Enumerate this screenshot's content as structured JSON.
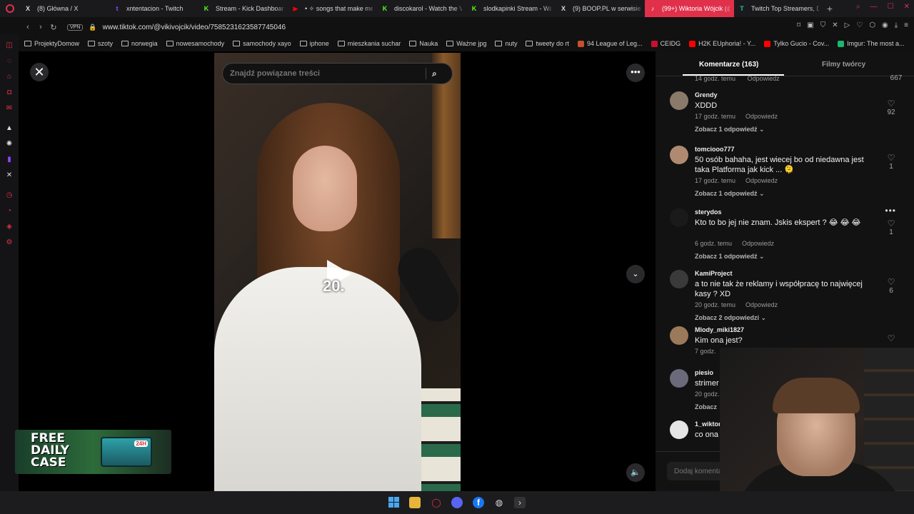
{
  "tabs": [
    {
      "label": "(8) Główna / X",
      "icon": "X",
      "color": "#dddddd",
      "active": false
    },
    {
      "label": "xntentacion - Twitch",
      "icon": "t",
      "color": "#9146ff",
      "active": false
    },
    {
      "label": "Stream - Kick Dashboard",
      "icon": "K",
      "color": "#53fc18",
      "active": false
    },
    {
      "label": "• ✧ songs that make me",
      "icon": "▶",
      "color": "#ff0000",
      "active": false
    },
    {
      "label": "discokarol - Watch the V",
      "icon": "K",
      "color": "#53fc18",
      "active": false
    },
    {
      "label": "slodkapinki Stream - Wat",
      "icon": "K",
      "color": "#53fc18",
      "active": false
    },
    {
      "label": "(9) BOOP.PL w serwisie",
      "icon": "X",
      "color": "#dddddd",
      "active": false
    },
    {
      "label": "(99+) Wiktoria Wójcik (@",
      "icon": "♪",
      "color": "#ffffff",
      "active": true
    },
    {
      "label": "Twitch Top Streamers, D",
      "icon": "T",
      "color": "#22c3a0",
      "active": false
    }
  ],
  "address": {
    "vpn": "VPN",
    "url": "www.tiktok.com/@vikivojcik/video/7585231623587745046"
  },
  "bookmarks": [
    {
      "label": "ProjektyDomow",
      "type": "folder"
    },
    {
      "label": "szoty",
      "type": "folder"
    },
    {
      "label": "norwegia",
      "type": "folder"
    },
    {
      "label": "nowesamochody",
      "type": "folder"
    },
    {
      "label": "samochody xayo",
      "type": "folder"
    },
    {
      "label": "iphone",
      "type": "folder"
    },
    {
      "label": "mieszkania suchar",
      "type": "folder"
    },
    {
      "label": "Nauka",
      "type": "folder"
    },
    {
      "label": "Ważne jpg",
      "type": "folder"
    },
    {
      "label": "nuty",
      "type": "folder"
    },
    {
      "label": "tweety do rt",
      "type": "folder"
    },
    {
      "label": "94 League of Leg...",
      "type": "site",
      "color": "#c8502a"
    },
    {
      "label": "CEIDG",
      "type": "site",
      "color": "#c8102e"
    },
    {
      "label": "H2K EUphoria! - Y...",
      "type": "site",
      "color": "#ff0000"
    },
    {
      "label": "Tylko Gucio - Cov...",
      "type": "site",
      "color": "#ff0000"
    },
    {
      "label": "Imgur: The most a...",
      "type": "site",
      "color": "#1bb76e"
    }
  ],
  "search": {
    "placeholder": "Znajdź powiązane treści"
  },
  "video": {
    "overlay_number": "20."
  },
  "ad": {
    "line1": "FREE",
    "line2": "DAILY",
    "line3": "CASE",
    "badge": "24H"
  },
  "panel": {
    "tab_comments": "Komentarze (163)",
    "tab_creator": "Filmy twórcy",
    "top_meta_time": "14 godz. temu",
    "top_meta_reply": "Odpowiedz",
    "top_likes": "667",
    "add_comment_placeholder": "Dodaj komentarz...",
    "comments": [
      {
        "user": "Grendy",
        "text": "XDDD",
        "time": "17 godz. temu",
        "reply": "Odpowiedz",
        "view": "Zobacz 1 odpowiedź ⌄",
        "likes": "92"
      },
      {
        "user": "tomciooo777",
        "text": "50 osób bahaha, jest wiecej bo od niedawna jest taka Platforma jak kick ... 🫠",
        "time": "17 godz. temu",
        "reply": "Odpowiedz",
        "view": "Zobacz 1 odpowiedź ⌄",
        "likes": "1"
      },
      {
        "user": "sterydos",
        "text": "Kto to bo jej nie znam. Jskis ekspert ? 😂 😂 😂",
        "time": "6 godz. temu",
        "reply": "Odpowiedz",
        "view": "Zobacz 1 odpowiedź ⌄",
        "likes": "1"
      },
      {
        "user": "KamiProject",
        "text": "a to nie tak że reklamy i współpracę to najwięcej kasy ? XD",
        "time": "20 godz. temu",
        "reply": "Odpowiedz",
        "view": "Zobacz 2 odpowiedzi ⌄",
        "likes": "6"
      },
      {
        "user": "Mlody_miki1827",
        "text": "Kim ona jest?",
        "time": "7 godz.",
        "reply": "",
        "view": "",
        "likes": ""
      },
      {
        "user": "piesio",
        "text": "strimer",
        "time": "20 godz.",
        "reply": "",
        "view": "Zobacz",
        "likes": ""
      },
      {
        "user": "1_wiktor",
        "text": "co ona",
        "time": "",
        "reply": "",
        "view": "",
        "likes": ""
      }
    ]
  },
  "colors": {
    "accent": "#e0304a",
    "background": "#000000",
    "panel": "#121212"
  }
}
